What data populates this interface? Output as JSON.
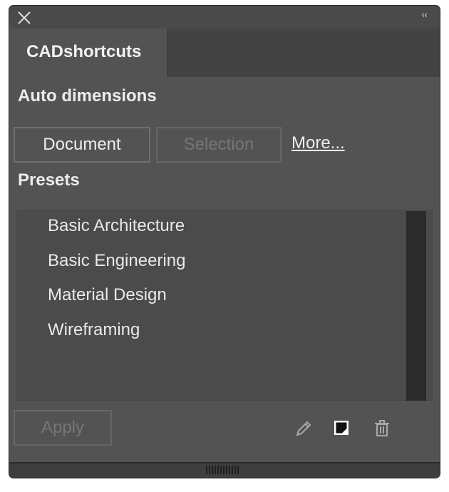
{
  "window": {
    "close_icon": "close-icon",
    "collapse_label": "‹‹"
  },
  "tabs": [
    {
      "label": "CADshortcuts",
      "active": true
    }
  ],
  "auto_dimensions": {
    "heading": "Auto dimensions",
    "document_button": "Document",
    "selection_button": "Selection",
    "more_link": "More..."
  },
  "presets": {
    "heading": "Presets",
    "items": [
      {
        "label": "Basic Architecture"
      },
      {
        "label": "Basic Engineering"
      },
      {
        "label": "Material Design"
      },
      {
        "label": "Wireframing"
      }
    ]
  },
  "footer": {
    "apply_button": "Apply",
    "icons": [
      "pencil-icon",
      "new-preset-icon",
      "trash-icon"
    ]
  },
  "colors": {
    "panel_bg": "#535353",
    "list_bg": "#4b4b4b",
    "scrollbar": "#2b2b2b",
    "text": "#ececec",
    "disabled_text": "#767676"
  }
}
